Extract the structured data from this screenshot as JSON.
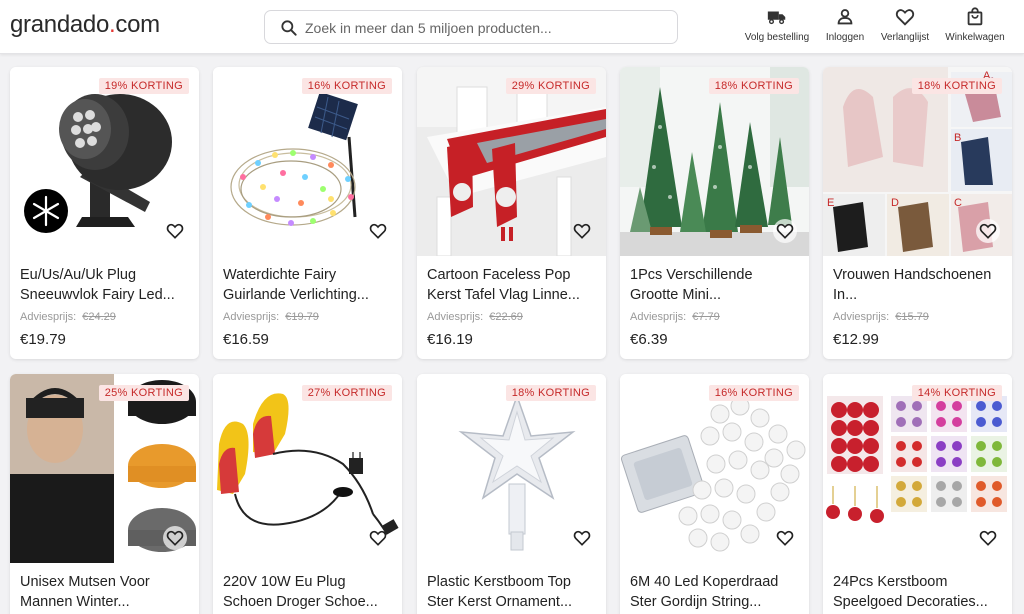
{
  "header": {
    "logo_main": "grandado",
    "logo_dot": ".",
    "logo_tld": "com",
    "search_placeholder": "Zoek in meer dan 5 miljoen producten...",
    "nav": {
      "track": "Volg bestelling",
      "login": "Inloggen",
      "wishlist": "Verlanglijst",
      "cart": "Winkelwagen"
    }
  },
  "rrp_label": "Adviesprijs:",
  "products": [
    {
      "badge": "19% KORTING",
      "title": "Eu/Us/Au/Uk Plug Sneeuwvlok Fairy Led...",
      "old_price": "€24.29",
      "price": "€19.79"
    },
    {
      "badge": "16% KORTING",
      "title": "Waterdichte Fairy Guirlande Verlichting...",
      "old_price": "€19.79",
      "price": "€16.59"
    },
    {
      "badge": "29% KORTING",
      "title": "Cartoon Faceless Pop Kerst Tafel Vlag Linne...",
      "old_price": "€22.69",
      "price": "€16.19"
    },
    {
      "badge": "18% KORTING",
      "title": "1Pcs Verschillende Grootte Mini...",
      "old_price": "€7.79",
      "price": "€6.39"
    },
    {
      "badge": "18% KORTING",
      "title": "Vrouwen Handschoenen In...",
      "old_price": "€15.79",
      "price": "€12.99"
    },
    {
      "badge": "25% KORTING",
      "title": "Unisex Mutsen Voor Mannen Winter..."
    },
    {
      "badge": "27% KORTING",
      "title": "220V 10W Eu Plug Schoen Droger Schoe..."
    },
    {
      "badge": "18% KORTING",
      "title": "Plastic Kerstboom Top Ster Kerst Ornament..."
    },
    {
      "badge": "16% KORTING",
      "title": "6M 40 Led Koperdraad Ster Gordijn String..."
    },
    {
      "badge": "14% KORTING",
      "title": "24Pcs Kerstboom Speelgoed Decoraties..."
    }
  ],
  "image_labels": {
    "gloves": [
      "A",
      "B",
      "C",
      "D",
      "E"
    ]
  }
}
